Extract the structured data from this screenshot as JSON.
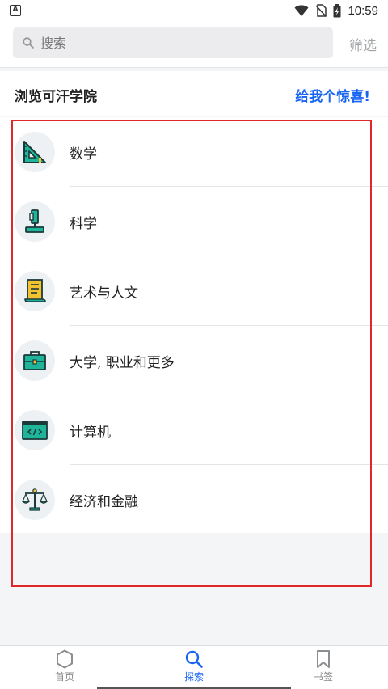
{
  "status": {
    "time": "10:59",
    "app_badge": "A"
  },
  "search": {
    "placeholder": "搜索",
    "filter_label": "筛选"
  },
  "section": {
    "title": "浏览可汗学院",
    "surprise_label": "给我个惊喜!"
  },
  "categories": [
    {
      "label": "数学",
      "icon": "triangle-ruler-icon"
    },
    {
      "label": "科学",
      "icon": "microscope-icon"
    },
    {
      "label": "艺术与人文",
      "icon": "scroll-icon"
    },
    {
      "label": "大学, 职业和更多",
      "icon": "briefcase-icon"
    },
    {
      "label": "计算机",
      "icon": "code-window-icon"
    },
    {
      "label": "经济和金融",
      "icon": "balance-scale-icon"
    }
  ],
  "nav": {
    "items": [
      {
        "label": "首页",
        "icon": "hexagon-home-icon",
        "active": false
      },
      {
        "label": "探索",
        "icon": "search-icon",
        "active": true
      },
      {
        "label": "书签",
        "icon": "bookmark-icon",
        "active": false
      }
    ]
  },
  "colors": {
    "accent": "#1865f2",
    "icon_teal": "#1fb59a",
    "frame_red": "#e0282b"
  }
}
